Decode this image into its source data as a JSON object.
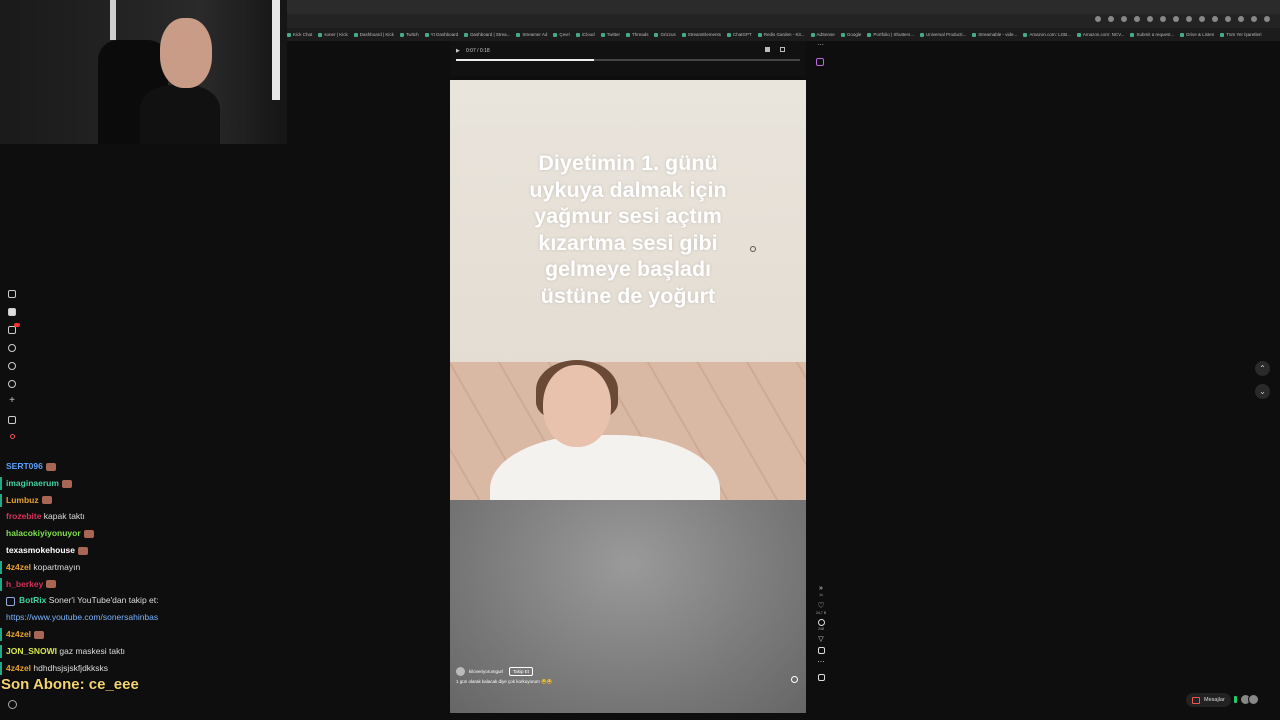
{
  "bookmarks": [
    "Kick Chat",
    "soner | Kick",
    "Dashboard | Kick",
    "Twitch",
    "Yt Dashboard",
    "Dashboard | Strea...",
    "Streamer Ad",
    "Çevri",
    "iCloud",
    "Twitter",
    "Threads",
    "Grizzus",
    "StreamElements",
    "ChatGPT",
    "Redis Garden - Kit...",
    "AdSense",
    "Google",
    "Portfolio | Shutters...",
    "Universal Producti...",
    "Streamable - vide...",
    "Amazon.com: LGB...",
    "Amazon.com: NCV...",
    "Submit a request...",
    "Drive & Listen",
    "Tüm Yer İşaretleri"
  ],
  "player": {
    "time": "0:07 / 0:18",
    "progress": 0.4
  },
  "video": {
    "caption_lines": [
      "Diyetimin 1. günü",
      "uykuya dalmak için",
      "yağmur sesi açtım",
      "kızartma sesi gibi",
      "gelmeye başladı",
      "üstüne de yoğurt"
    ],
    "username": "kiloveriyorumgurl",
    "follow_label": "Takip Et",
    "description": "1 gün olarak kalacak diye çok korkuyorum 😂😂"
  },
  "actions": {
    "speed": "1x",
    "likes": "24,7 B",
    "comments": "248"
  },
  "chat": [
    {
      "user": "SERT096",
      "color": "#5aa0ff",
      "text": "",
      "emote": true,
      "bar": false
    },
    {
      "user": "imaginaerum",
      "color": "#3fd1a0",
      "text": "",
      "emote": true,
      "bar": true
    },
    {
      "user": "Lumbuz",
      "color": "#e8a12c",
      "text": "",
      "emote": true,
      "bar": true
    },
    {
      "user": "frozebite",
      "color": "#d9305a",
      "text": "kapak taktı",
      "emote": false,
      "bar": false
    },
    {
      "user": "halacokiyiyonuyor",
      "color": "#7fe04a",
      "text": "",
      "emote": true,
      "bar": false
    },
    {
      "user": "texasmokehouse",
      "color": "#ffffff",
      "text": "",
      "emote": true,
      "bar": false
    },
    {
      "user": "4z4zel",
      "color": "#e8a12c",
      "text": "kopartmayın",
      "emote": false,
      "bar": true
    },
    {
      "user": "h_berkey",
      "color": "#d9305a",
      "text": "",
      "emote": true,
      "bar": true
    },
    {
      "user": "BotRix",
      "color": "#3fd1a0",
      "text": "Soner'i YouTube'dan takip et:",
      "emote": false,
      "bar": false
    },
    {
      "user": "",
      "color": "#7ab4ff",
      "text": "https://www.youtube.com/sonersahinbas",
      "emote": false,
      "bar": false
    },
    {
      "user": "4z4zel",
      "color": "#e8a12c",
      "text": "",
      "emote": true,
      "bar": true
    },
    {
      "user": "JON_SNOWI",
      "color": "#d8e84a",
      "text": "gaz maskesi taktı",
      "emote": false,
      "bar": true
    },
    {
      "user": "4z4zel",
      "color": "#e8a12c",
      "text": "hdhdhsjsjskfjdkksks",
      "emote": false,
      "bar": true
    }
  ],
  "son_abone": "Son Abone: ce_eee",
  "messages_label": "Mesajlar"
}
